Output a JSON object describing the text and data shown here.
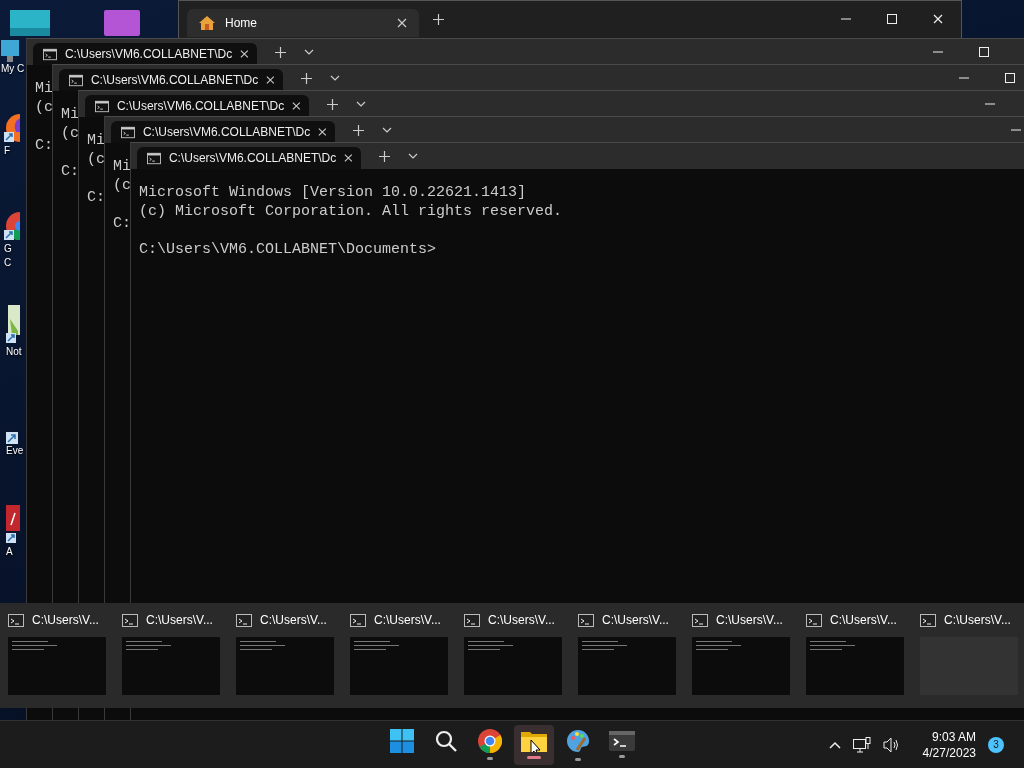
{
  "desktop_icons": [
    {
      "kind": "teal-app"
    },
    {
      "kind": "purple-app"
    },
    {
      "kind": "pc",
      "label_lines": [
        "My C"
      ]
    },
    {
      "kind": "browser-orange",
      "label_lines": [
        "F"
      ]
    },
    {
      "kind": "browser-round",
      "label_lines": [
        "G",
        "C"
      ]
    },
    {
      "kind": "notepad",
      "label_lines": [
        "Not"
      ]
    },
    {
      "kind": "shortcut",
      "label_lines": [
        "Eve"
      ]
    },
    {
      "kind": "acrobat",
      "label_lines": [
        "A"
      ]
    }
  ],
  "explorer_window": {
    "tab_title": "Home"
  },
  "terminal_windows": [
    {
      "tab_title": "C:\\Users\\VM6.COLLABNET\\Dc",
      "output": [
        "Mi",
        "(c"
      ],
      "prompt": "C:"
    },
    {
      "tab_title": "C:\\Users\\VM6.COLLABNET\\Dc",
      "output": [
        "Mi",
        "(c"
      ],
      "prompt": "C:"
    },
    {
      "tab_title": "C:\\Users\\VM6.COLLABNET\\Dc",
      "output": [
        "Mi",
        "(c"
      ],
      "prompt": "C:"
    },
    {
      "tab_title": "C:\\Users\\VM6.COLLABNET\\Dc",
      "output": [
        "Mi",
        "(c"
      ],
      "prompt": "C:"
    },
    {
      "tab_title": "C:\\Users\\VM6.COLLABNET\\Dc",
      "output": [
        "Microsoft Windows [Version 10.0.22621.1413]",
        "(c) Microsoft Corporation. All rights reserved."
      ],
      "prompt": "C:\\Users\\VM6.COLLABNET\\Documents>"
    }
  ],
  "thumbnails": [
    {
      "title": "C:\\Users\\V...",
      "preview": true
    },
    {
      "title": "C:\\Users\\V...",
      "preview": true
    },
    {
      "title": "C:\\Users\\V...",
      "preview": true
    },
    {
      "title": "C:\\Users\\V...",
      "preview": true
    },
    {
      "title": "C:\\Users\\V...",
      "preview": true
    },
    {
      "title": "C:\\Users\\V...",
      "preview": true
    },
    {
      "title": "C:\\Users\\V...",
      "preview": true
    },
    {
      "title": "C:\\Users\\V...",
      "preview": true
    },
    {
      "title": "C:\\Users\\V...",
      "preview": false
    }
  ],
  "taskbar": {
    "apps": [
      {
        "kind": "start",
        "running": false,
        "selected": false
      },
      {
        "kind": "search",
        "running": false,
        "selected": false
      },
      {
        "kind": "chrome",
        "running": true,
        "selected": false
      },
      {
        "kind": "explorer",
        "running": true,
        "selected": true
      },
      {
        "kind": "paint",
        "running": true,
        "selected": false
      },
      {
        "kind": "terminal",
        "running": true,
        "selected": false
      }
    ],
    "time": "9:03 AM",
    "date": "4/27/2023",
    "notification_count": "3"
  }
}
